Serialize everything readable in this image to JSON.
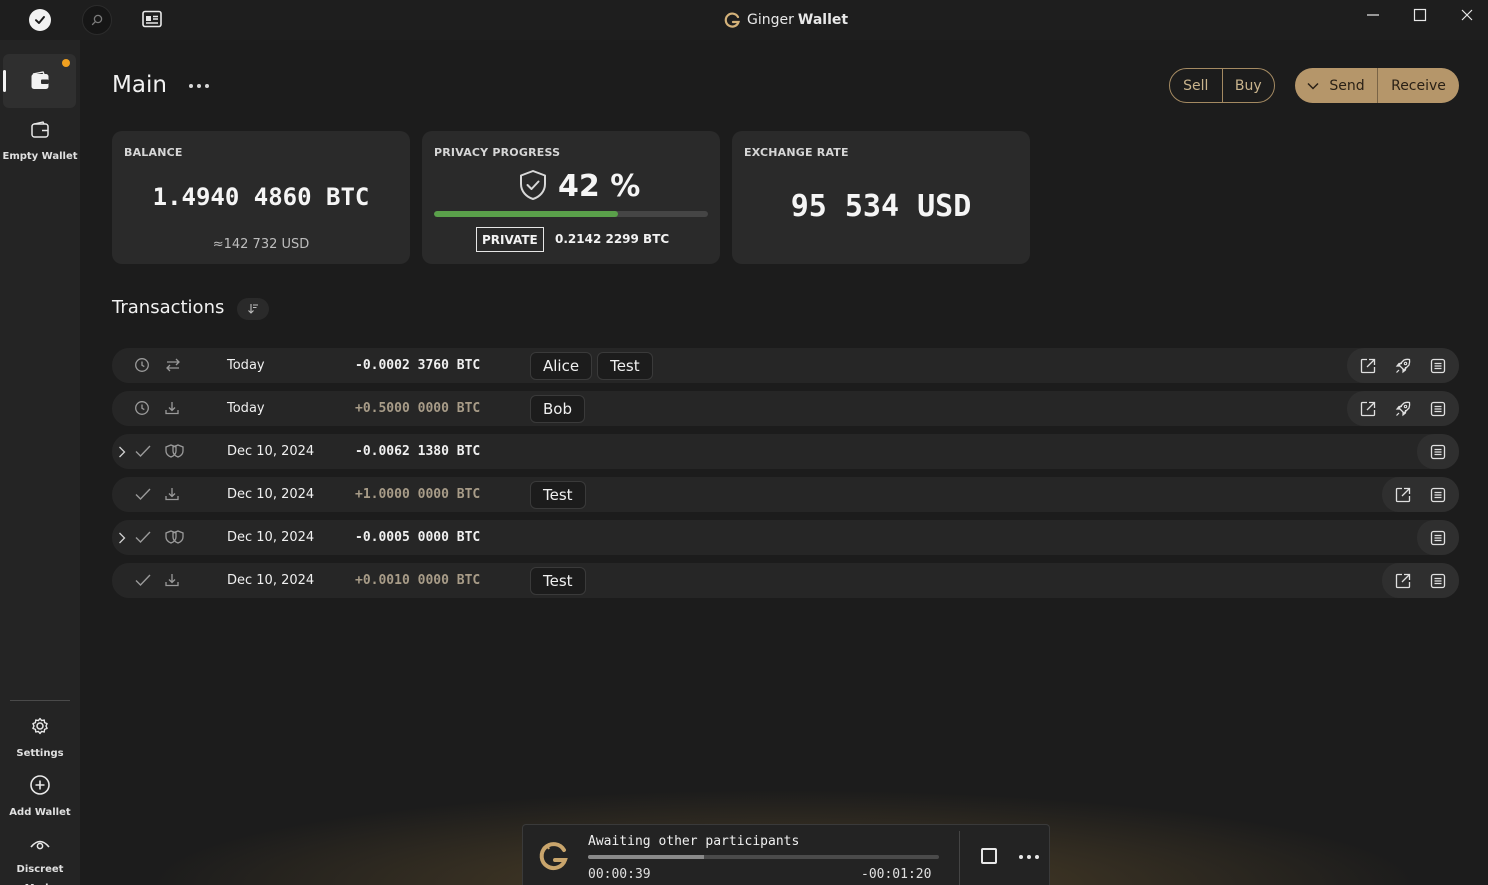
{
  "app": {
    "title_light": "Ginger",
    "title_bold": "Wallet"
  },
  "sidebar": {
    "items": [
      {
        "label": "Empty Wallet",
        "icon": "wallet-icon"
      },
      {
        "label": "Settings",
        "icon": "gear-icon"
      },
      {
        "label": "Add Wallet",
        "icon": "plus-circle-icon"
      },
      {
        "label": "Discreet Mode",
        "icon": "eye-icon"
      }
    ]
  },
  "header": {
    "title": "Main",
    "sell": "Sell",
    "buy": "Buy",
    "send": "Send",
    "receive": "Receive"
  },
  "tiles": {
    "balance": {
      "label": "BALANCE",
      "btc": "1.4940 4860 BTC",
      "usd": "≈142 732 USD"
    },
    "privacy": {
      "label": "PRIVACY PROGRESS",
      "percent": "42 %",
      "progress_fraction": 0.67,
      "badge": "PRIVATE",
      "amount": "0.2142 2299 BTC"
    },
    "exchange": {
      "label": "EXCHANGE RATE",
      "value": "95 534 USD"
    }
  },
  "transactions": {
    "title": "Transactions",
    "rows": [
      {
        "date": "Today",
        "amount": "-0.0002 3760 BTC",
        "sign": "neg",
        "labels": [
          "Alice",
          "Test"
        ],
        "status": "pending",
        "type": "transfer",
        "expandable": false,
        "actions": [
          "open-external-icon",
          "speedup-icon",
          "details-icon"
        ]
      },
      {
        "date": "Today",
        "amount": "+0.5000 0000 BTC",
        "sign": "pos",
        "labels": [
          "Bob"
        ],
        "status": "pending",
        "type": "incoming",
        "expandable": false,
        "actions": [
          "open-external-icon",
          "speedup-icon",
          "details-icon"
        ]
      },
      {
        "date": "Dec 10, 2024",
        "amount": "-0.0062 1380 BTC",
        "sign": "neg",
        "labels": [],
        "status": "confirmed",
        "type": "coinjoin",
        "expandable": true,
        "actions": [
          "details-icon"
        ]
      },
      {
        "date": "Dec 10, 2024",
        "amount": "+1.0000 0000 BTC",
        "sign": "pos",
        "labels": [
          "Test"
        ],
        "status": "confirmed",
        "type": "incoming",
        "expandable": false,
        "actions": [
          "open-external-icon",
          "details-icon"
        ]
      },
      {
        "date": "Dec 10, 2024",
        "amount": "-0.0005 0000 BTC",
        "sign": "neg",
        "labels": [],
        "status": "confirmed",
        "type": "coinjoin",
        "expandable": true,
        "actions": [
          "details-icon"
        ]
      },
      {
        "date": "Dec 10, 2024",
        "amount": "+0.0010 0000 BTC",
        "sign": "pos",
        "labels": [
          "Test"
        ],
        "status": "confirmed",
        "type": "incoming",
        "expandable": false,
        "actions": [
          "open-external-icon",
          "details-icon"
        ]
      }
    ]
  },
  "coinjoin": {
    "status": "Awaiting other participants",
    "elapsed": "00:00:39",
    "remaining": "-00:01:20",
    "progress_fraction": 0.33
  }
}
